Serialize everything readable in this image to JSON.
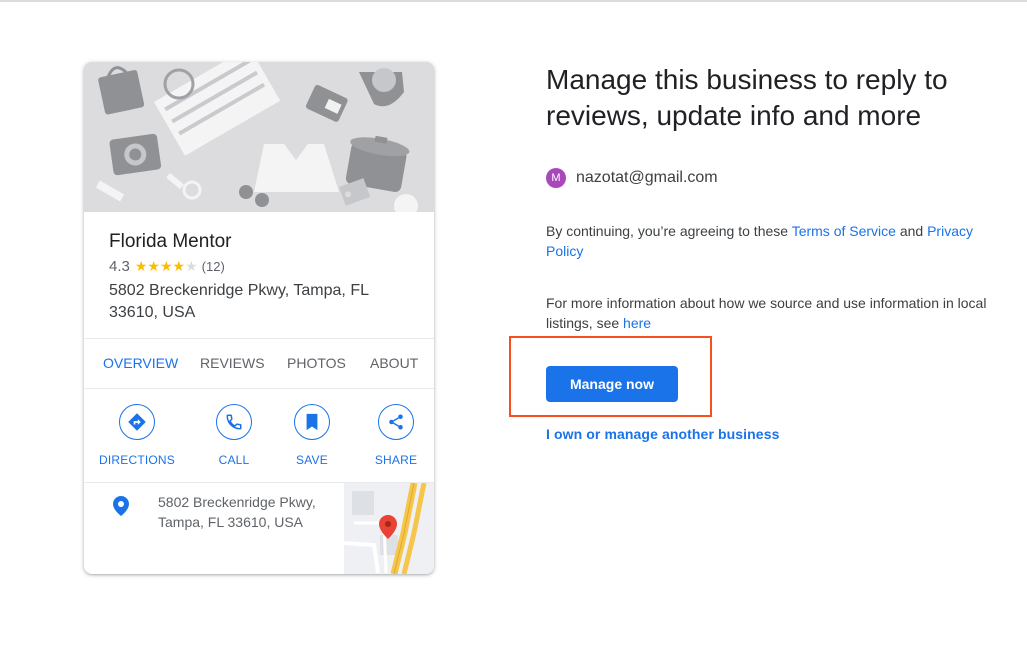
{
  "card": {
    "name": "Florida Mentor",
    "rating": "4.3",
    "stars_filled": 4,
    "stars_total": 5,
    "review_count": "(12)",
    "address_line1": "5802 Breckenridge Pkwy, Tampa, FL",
    "address_line2": "33610, USA",
    "tabs": [
      {
        "label": "OVERVIEW",
        "active": true
      },
      {
        "label": "REVIEWS",
        "active": false
      },
      {
        "label": "PHOTOS",
        "active": false
      },
      {
        "label": "ABOUT",
        "active": false
      }
    ],
    "actions": [
      {
        "label": "DIRECTIONS",
        "icon": "directions-icon"
      },
      {
        "label": "CALL",
        "icon": "phone-icon"
      },
      {
        "label": "SAVE",
        "icon": "bookmark-icon"
      },
      {
        "label": "SHARE",
        "icon": "share-icon"
      }
    ],
    "map_address_line1": "5802 Breckenridge Pkwy,",
    "map_address_line2": "Tampa, FL 33610, USA"
  },
  "panel": {
    "headline": "Manage this business to reply to reviews, update info and more",
    "avatar_initial": "M",
    "email": "nazotat@gmail.com",
    "terms_prefix": "By continuing, you’re agreeing to these ",
    "terms_link": "Terms of Service",
    "terms_and": " and ",
    "privacy_link": "Privacy Policy",
    "info_text": "For more information about how we source and use information in local listings, see ",
    "info_link": "here",
    "manage_button": "Manage now",
    "other_business_link": "I own or manage another business"
  },
  "colors": {
    "accent": "#1a73e8",
    "star": "#fbbc04",
    "avatar": "#ab47bc",
    "highlight_box": "#f4511e",
    "map_pin": "#ea4335"
  }
}
